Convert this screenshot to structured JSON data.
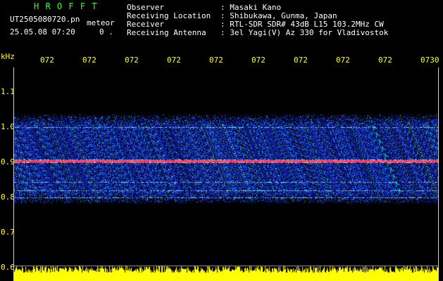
{
  "app": {
    "logo": "H R O F F T",
    "filename": "UT2505080720.pn",
    "mode": "meteor",
    "datetime": "25.05.08 07:20",
    "counter": "0 ."
  },
  "info": [
    {
      "label": "Observer",
      "value": ": Masaki Kano"
    },
    {
      "label": "Receiving Location",
      "value": ": Shibukawa, Gunma, Japan"
    },
    {
      "label": "Receiver",
      "value": ": RTL-SDR SDR# 43dB L15 103.2MHz CW"
    },
    {
      "label": "Receiving Antenna",
      "value": ": 3el Yagi(V) Az 330 for Vladivostok"
    }
  ],
  "axis": {
    "unit": "kHz",
    "y_ticks": [
      "1.1",
      "1.0",
      "0.9",
      "0.8",
      "0.7",
      "0.6"
    ],
    "x_ticks": [
      "072",
      "072",
      "072",
      "072",
      "072",
      "072",
      "072",
      "072",
      "072",
      "0730"
    ]
  },
  "colors": {
    "text": "#ffffff",
    "logo": "#2fff2f",
    "ticks": "#ffff33",
    "noise": "#0a1a9a",
    "echo_band": "#ff2a5a",
    "level": "#ffff00"
  },
  "spectrogram": {
    "y_range_khz": [
      0.6,
      1.15
    ],
    "noise_band_khz": [
      0.785,
      1.035
    ],
    "carrier_khz": 0.905,
    "faint_lines_khz": [
      1.0,
      0.845,
      0.82,
      0.8
    ]
  }
}
